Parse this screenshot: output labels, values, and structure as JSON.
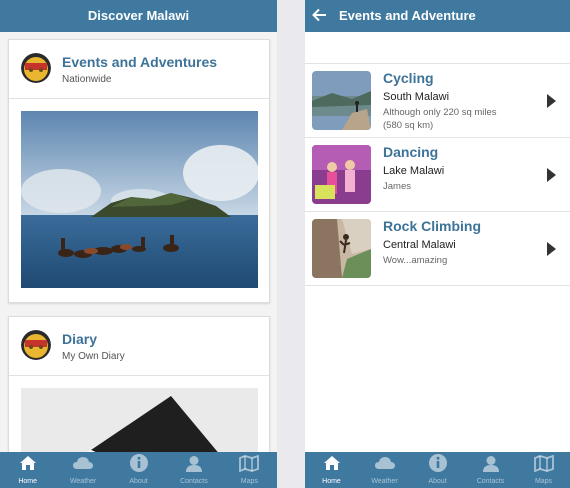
{
  "left_screen": {
    "title": "Discover Malawi",
    "cards": [
      {
        "title": "Events and Adventures",
        "subtitle": "Nationwide"
      },
      {
        "title": "Diary",
        "subtitle": "My Own Diary"
      }
    ]
  },
  "right_screen": {
    "title": "Events and Adventure",
    "items": [
      {
        "title": "Cycling",
        "location": "South Malawi",
        "description": "Although only 220 sq miles (580 sq km)"
      },
      {
        "title": "Dancing",
        "location": "Lake Malawi",
        "description": "James"
      },
      {
        "title": "Rock Climbing",
        "location": "Central Malawi",
        "description": "Wow...amazing"
      }
    ]
  },
  "tabs": [
    {
      "label": "Home",
      "icon": "home-icon"
    },
    {
      "label": "Weather",
      "icon": "cloud-icon"
    },
    {
      "label": "About",
      "icon": "info-icon"
    },
    {
      "label": "Contacts",
      "icon": "person-icon"
    },
    {
      "label": "Maps",
      "icon": "map-icon"
    }
  ],
  "colors": {
    "header": "#3f79a0",
    "title_text": "#3d7398"
  }
}
